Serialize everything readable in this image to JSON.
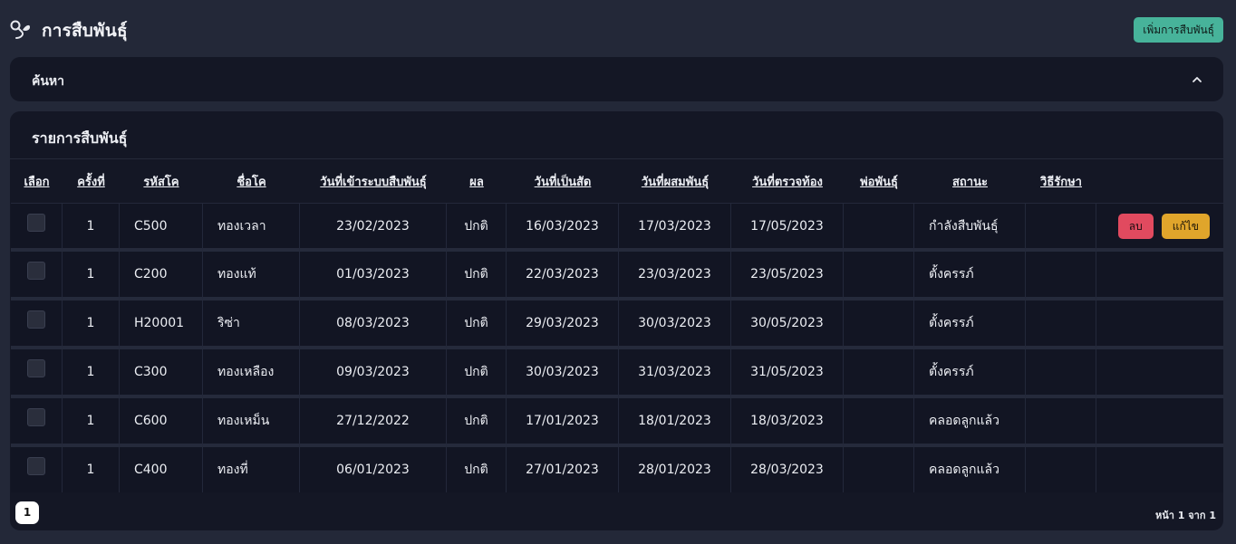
{
  "header": {
    "title": "การสืบพันธุ์",
    "icon": "sperm-icon",
    "add_button": "เพิ่มการสืบพันธุ์"
  },
  "search": {
    "title": "ค้นหา",
    "toggle_icon": "chevron-up-icon"
  },
  "list": {
    "title": "รายการสืบพันธุ์",
    "columns": [
      "เลือก",
      "ครั้งที่",
      "รหัสโค",
      "ชื่อโค",
      "วันที่เข้าระบบสืบพันธุ์",
      "ผล",
      "วันที่เป็นสัด",
      "วันที่ผสมพันธุ์",
      "วันที่ตรวจท้อง",
      "พ่อพันธุ์",
      "สถานะ",
      "วิธีรักษา",
      ""
    ],
    "rows": [
      {
        "round": "1",
        "code": "C500",
        "name": "ทองเวลา",
        "enter_date": "23/02/2023",
        "result": "ปกติ",
        "heat_date": "16/03/2023",
        "breed_date": "17/03/2023",
        "check_date": "17/05/2023",
        "sire": "",
        "status": "กำลังสืบพันธุ์",
        "treatment": "",
        "delete_label": "ลบ",
        "edit_label": "แก้ไข"
      },
      {
        "round": "1",
        "code": "C200",
        "name": "ทองแท้",
        "enter_date": "01/03/2023",
        "result": "ปกติ",
        "heat_date": "22/03/2023",
        "breed_date": "23/03/2023",
        "check_date": "23/05/2023",
        "sire": "",
        "status": "ตั้งครรภ์",
        "treatment": ""
      },
      {
        "round": "1",
        "code": "H20001",
        "name": "ริซ่า",
        "enter_date": "08/03/2023",
        "result": "ปกติ",
        "heat_date": "29/03/2023",
        "breed_date": "30/03/2023",
        "check_date": "30/05/2023",
        "sire": "",
        "status": "ตั้งครรภ์",
        "treatment": ""
      },
      {
        "round": "1",
        "code": "C300",
        "name": "ทองเหลือง",
        "enter_date": "09/03/2023",
        "result": "ปกติ",
        "heat_date": "30/03/2023",
        "breed_date": "31/03/2023",
        "check_date": "31/05/2023",
        "sire": "",
        "status": "ตั้งครรภ์",
        "treatment": ""
      },
      {
        "round": "1",
        "code": "C600",
        "name": "ทองเหม็น",
        "enter_date": "27/12/2022",
        "result": "ปกติ",
        "heat_date": "17/01/2023",
        "breed_date": "18/01/2023",
        "check_date": "18/03/2023",
        "sire": "",
        "status": "คลอดลูกแล้ว",
        "treatment": ""
      },
      {
        "round": "1",
        "code": "C400",
        "name": "ทองที่",
        "enter_date": "06/01/2023",
        "result": "ปกติ",
        "heat_date": "27/01/2023",
        "breed_date": "28/01/2023",
        "check_date": "28/03/2023",
        "sire": "",
        "status": "คลอดลูกแล้ว",
        "treatment": ""
      }
    ]
  },
  "pagination": {
    "current_page": "1",
    "info": "หน้า 1 จาก 1"
  },
  "colors": {
    "background": "#232838",
    "panel": "#141725",
    "add_button": "#47b39a",
    "delete_button": "#e14a5f",
    "edit_button": "#e0a52b"
  }
}
